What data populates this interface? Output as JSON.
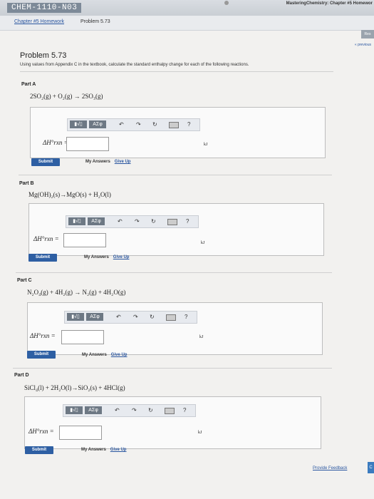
{
  "header": {
    "course": "CHEM-1110-N03",
    "app_title": "MasteringChemistry: Chapter #5 Homewor",
    "breadcrumb": "Chapter #5 Homework",
    "problem_tab": "Problem 5.73",
    "resources_button": "Res",
    "previous_link": "« previous"
  },
  "problem": {
    "title": "Problem 5.73",
    "instructions": "Using values from Appendix C in the textbook, calculate the standard enthalpy change for each of the following reactions."
  },
  "toolbar": {
    "matrix_label": "▮√▯",
    "greek_label": "ΑΣφ",
    "undo_icon": "undo-icon",
    "redo_icon": "redo-icon",
    "reset_icon": "reset-icon",
    "keyboard_icon": "keyboard-icon",
    "help_label": "?"
  },
  "answer": {
    "symbol": "ΔH°rxn =",
    "unit": "kJ",
    "submit_label": "Submit",
    "my_answers_label": "My Answers",
    "give_up_label": "Give Up"
  },
  "parts": [
    {
      "label": "Part A",
      "equation": "2SO₂(g) + O₂(g) → 2SO₃(g)"
    },
    {
      "label": "Part B",
      "equation": "Mg(OH)₂(s)→MgO(s) + H₂O(l)"
    },
    {
      "label": "Part C",
      "equation": "N₂O₄(g) + 4H₂(g) → N₂(g) + 4H₂O(g)"
    },
    {
      "label": "Part D",
      "equation": "SiCl₄(l) + 2H₂O(l)→SiO₂(s) + 4HCl(g)"
    }
  ],
  "footer": {
    "feedback_link": "Provide Feedback",
    "corner_button": "C"
  }
}
